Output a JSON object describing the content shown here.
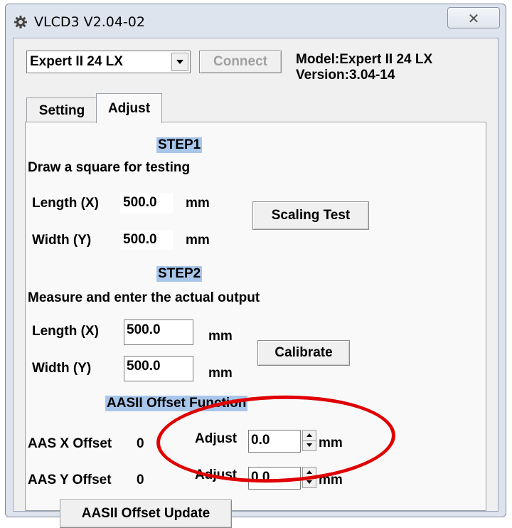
{
  "window": {
    "title": "VLCD3 V2.04-02",
    "close_glyph": "✕",
    "app_icon": "gear-icon"
  },
  "toolbar": {
    "model_select": {
      "value": "Expert II 24 LX"
    },
    "connect_label": "Connect",
    "model_line": "Model:Expert II 24 LX",
    "version_line": "Version:3.04-14"
  },
  "tabs": [
    {
      "label": "Setting",
      "active": false
    },
    {
      "label": "Adjust",
      "active": true
    }
  ],
  "step1": {
    "heading": "STEP1",
    "description": "Draw a square for testing",
    "length_label": "Length (X)",
    "length_value": "500.0",
    "length_unit": "mm",
    "width_label": "Width (Y)",
    "width_value": "500.0",
    "width_unit": "mm",
    "scaling_test_label": "Scaling Test"
  },
  "step2": {
    "heading": "STEP2",
    "description": "Measure and enter the actual output",
    "length_label": "Length (X)",
    "length_value": "500.0",
    "length_unit": "mm",
    "width_label": "Width (Y)",
    "width_value": "500.0",
    "width_unit": "mm",
    "calibrate_label": "Calibrate"
  },
  "aas": {
    "heading": "AASII Offset Function",
    "x_label": "AAS X Offset",
    "x_value": "0",
    "y_label": "AAS Y Offset",
    "y_value": "0",
    "adjust_label": "Adjust",
    "x_adjust_value": "0.0",
    "y_adjust_value": "0.0",
    "unit": "mm",
    "update_label": "AASII Offset Update"
  },
  "annotation": {
    "color": "#e00000"
  }
}
